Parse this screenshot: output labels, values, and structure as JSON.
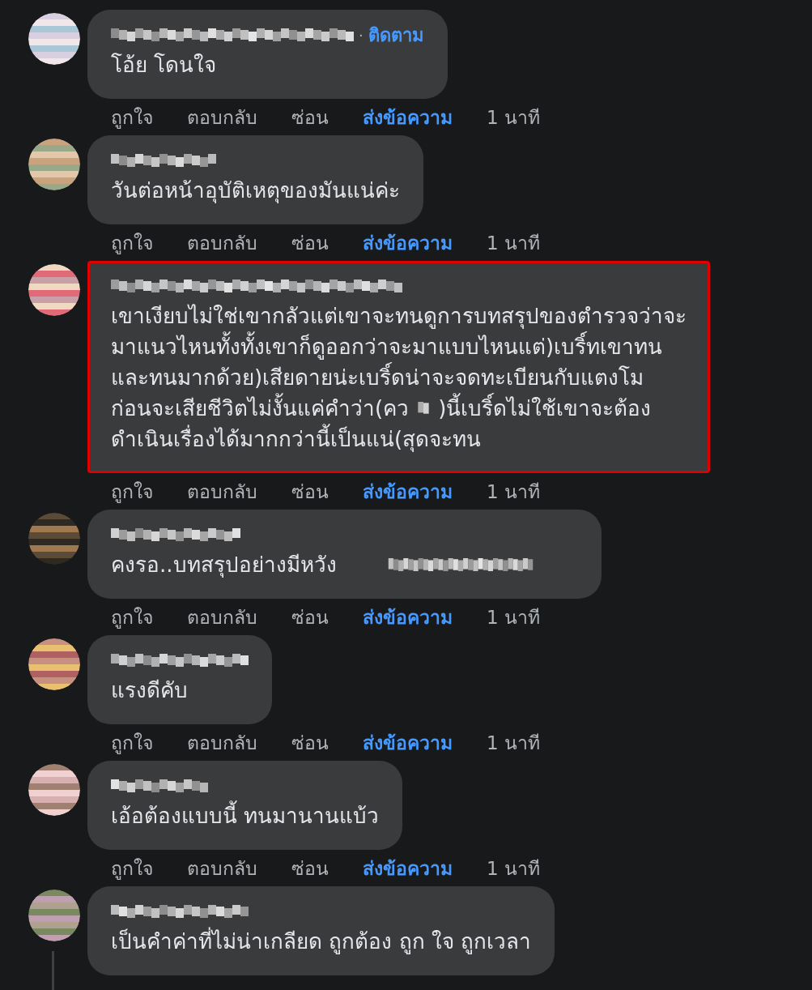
{
  "comments": [
    {
      "separator": "·",
      "follow": "ติดตาม",
      "highlighted": false,
      "lines": [
        [
          {
            "kind": "text",
            "text": "โอ้ย โดนใจ"
          }
        ]
      ],
      "actions": [
        {
          "label": "ถูกใจ",
          "kind": "action"
        },
        {
          "label": "ตอบกลับ",
          "kind": "action"
        },
        {
          "label": "ซ่อน",
          "kind": "action"
        },
        {
          "label": "ส่งข้อความ",
          "kind": "message"
        },
        {
          "label": "1 นาที",
          "kind": "time"
        }
      ]
    },
    {
      "highlighted": false,
      "lines": [
        [
          {
            "kind": "text",
            "text": "วันต่อหน้าอุบัติเหตุของมันแน่ค่ะ"
          }
        ]
      ],
      "actions": [
        {
          "label": "ถูกใจ",
          "kind": "action"
        },
        {
          "label": "ตอบกลับ",
          "kind": "action"
        },
        {
          "label": "ซ่อน",
          "kind": "action"
        },
        {
          "label": "ส่งข้อความ",
          "kind": "message"
        },
        {
          "label": "1 นาที",
          "kind": "time"
        }
      ]
    },
    {
      "highlighted": true,
      "lines": [
        [
          {
            "kind": "text",
            "text": "เขาเงียบไม่ใช่เขากลัวแต่เขาจะทนดูการบทสรุปของตำรวจว่าจะ"
          }
        ],
        [
          {
            "kind": "text",
            "text": "มาแนวไหนทั้งทั้งเขาก็ดูออกว่าจะมาแบบไหนแต่)เบริ์ทเขาทน"
          }
        ],
        [
          {
            "kind": "text",
            "text": "และทนมากด้วย)เสียดายน่ะเบริ์ดน่าจะจดทะเบียนกับแตงโม"
          }
        ],
        [
          {
            "kind": "text",
            "text": "ก่อนจะเสียชีวิตไม่งั้นแค่คำว่า(คว"
          },
          {
            "kind": "redacted"
          },
          {
            "kind": "text",
            "text": ")นี้เบริ์ดไม่ใช้เขาจะต้อง"
          }
        ],
        [
          {
            "kind": "text",
            "text": "ดำเนินเรื่องได้มากกว่านี้เป็นแน่(สุดจะทน"
          }
        ]
      ],
      "actions": [
        {
          "label": "ถูกใจ",
          "kind": "action"
        },
        {
          "label": "ตอบกลับ",
          "kind": "action"
        },
        {
          "label": "ซ่อน",
          "kind": "action"
        },
        {
          "label": "ส่งข้อความ",
          "kind": "message"
        },
        {
          "label": "1 นาที",
          "kind": "time"
        }
      ]
    },
    {
      "highlighted": false,
      "lines": [
        [
          {
            "kind": "text",
            "text": "คงรอ..บทสรุปอย่างมีหวัง"
          },
          {
            "kind": "redacted_long"
          }
        ]
      ],
      "actions": [
        {
          "label": "ถูกใจ",
          "kind": "action"
        },
        {
          "label": "ตอบกลับ",
          "kind": "action"
        },
        {
          "label": "ซ่อน",
          "kind": "action"
        },
        {
          "label": "ส่งข้อความ",
          "kind": "message"
        },
        {
          "label": "1 นาที",
          "kind": "time"
        }
      ]
    },
    {
      "highlighted": false,
      "lines": [
        [
          {
            "kind": "text",
            "text": "แรงดีคับ"
          }
        ]
      ],
      "actions": [
        {
          "label": "ถูกใจ",
          "kind": "action"
        },
        {
          "label": "ตอบกลับ",
          "kind": "action"
        },
        {
          "label": "ซ่อน",
          "kind": "action"
        },
        {
          "label": "ส่งข้อความ",
          "kind": "message"
        },
        {
          "label": "1 นาที",
          "kind": "time"
        }
      ]
    },
    {
      "highlighted": false,
      "lines": [
        [
          {
            "kind": "text",
            "text": "เอ้อต้องแบบนี้ ทนมานานแบ้ว"
          }
        ]
      ],
      "actions": [
        {
          "label": "ถูกใจ",
          "kind": "action"
        },
        {
          "label": "ตอบกลับ",
          "kind": "action"
        },
        {
          "label": "ซ่อน",
          "kind": "action"
        },
        {
          "label": "ส่งข้อความ",
          "kind": "message"
        },
        {
          "label": "1 นาที",
          "kind": "time"
        }
      ]
    },
    {
      "highlighted": false,
      "thread_line": true,
      "lines": [
        [
          {
            "kind": "text",
            "text": "เป็นคำค่าที่ไม่น่าเกลียด ถูกต้อง ถูก ใจ ถูกเวลา"
          }
        ]
      ]
    }
  ]
}
